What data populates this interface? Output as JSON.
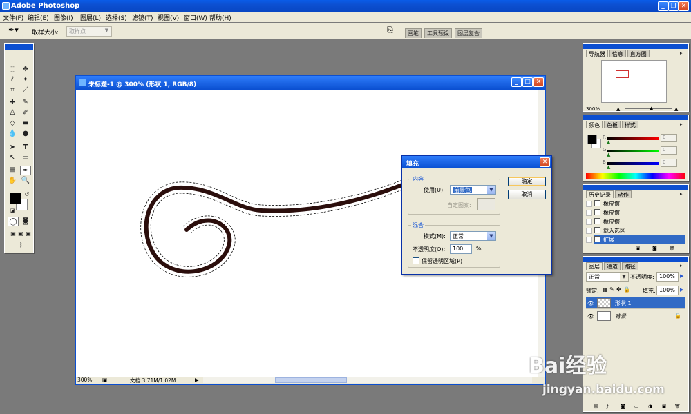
{
  "app": {
    "title": "Adobe Photoshop"
  },
  "menu": [
    "文件(F)",
    "编辑(E)",
    "图像(I)",
    "图层(L)",
    "选择(S)",
    "滤镜(T)",
    "视图(V)",
    "窗口(W)",
    "帮助(H)"
  ],
  "options": {
    "sample_label": "取样大小:",
    "sample_value": "取样点"
  },
  "palette_well": [
    "画笔",
    "工具预设",
    "图层复合"
  ],
  "document": {
    "title": "未标题-1 @ 300% (形状 1, RGB/8)",
    "zoom": "300%",
    "doc_info": "文档:3.71M/1.02M"
  },
  "fill_dialog": {
    "title": "填充",
    "contents_group": "内容",
    "use_label": "使用(U):",
    "use_value": "前景色",
    "pattern_label": "自定图案:",
    "blending_group": "混合",
    "mode_label": "模式(M):",
    "mode_value": "正常",
    "opacity_label": "不透明度(O):",
    "opacity_value": "100",
    "opacity_unit": "%",
    "preserve_label": "保留透明区域(P)",
    "ok_label": "确定",
    "cancel_label": "取消"
  },
  "navigator": {
    "tabs": [
      "导航器",
      "信息",
      "直方图"
    ],
    "zoom": "300%"
  },
  "color_panel": {
    "tabs": [
      "颜色",
      "色板",
      "样式"
    ],
    "channels": [
      "R",
      "G",
      "B"
    ],
    "values": [
      "0",
      "0",
      "0"
    ]
  },
  "history": {
    "tabs": [
      "历史记录",
      "动作"
    ],
    "items": [
      "橡皮擦",
      "橡皮擦",
      "橡皮擦",
      "载入选区",
      "扩展"
    ]
  },
  "layers": {
    "tabs": [
      "图层",
      "通道",
      "路径"
    ],
    "blend_mode": "正常",
    "opacity_label": "不透明度:",
    "opacity_value": "100%",
    "lock_label": "锁定:",
    "fill_label": "填充:",
    "fill_value": "100%",
    "items": [
      "形状 1",
      "背景"
    ]
  },
  "watermark": {
    "logo": "Bai经验",
    "url": "jingyan.baidu.com"
  },
  "colors": {
    "title_blue": "#0c4fd0",
    "stroke": "#3a1512",
    "selection": "#316ac5"
  }
}
